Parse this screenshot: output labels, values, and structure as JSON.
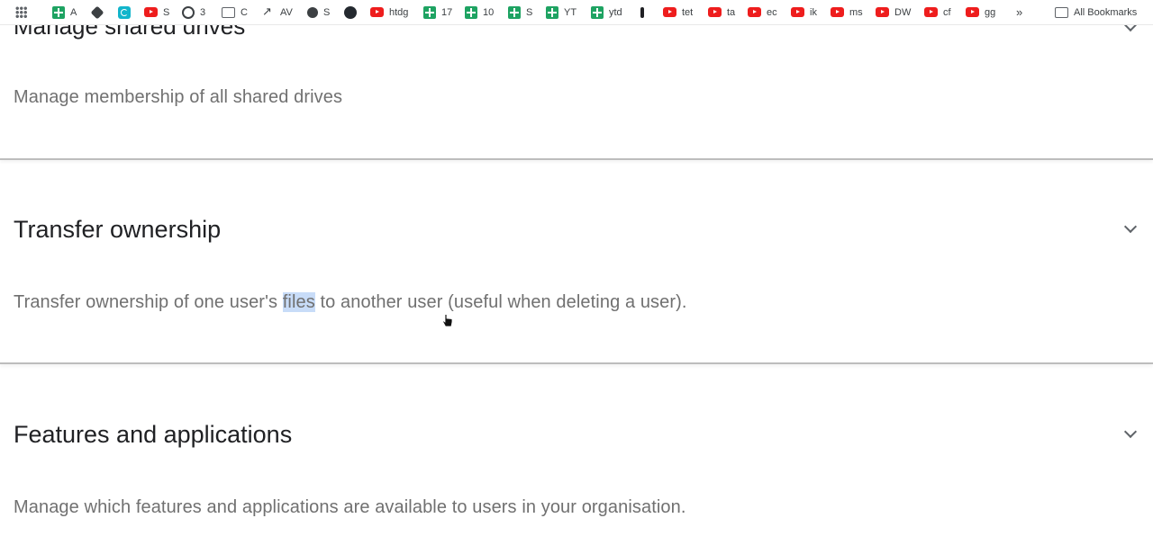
{
  "bookmarks_bar": {
    "items": [
      {
        "icon": "apps-grid-icon",
        "label": ""
      },
      {
        "icon": "sheets-icon",
        "label": "A"
      },
      {
        "icon": "puzzle-icon",
        "label": ""
      },
      {
        "icon": "cyan-app-icon",
        "label": ""
      },
      {
        "icon": "youtube-icon",
        "label": "S"
      },
      {
        "icon": "openai-icon",
        "label": "3"
      },
      {
        "icon": "folder-icon",
        "label": "C"
      },
      {
        "icon": "trend-icon",
        "label": "AV"
      },
      {
        "icon": "globe-icon",
        "label": "S"
      },
      {
        "icon": "github-icon",
        "label": ""
      },
      {
        "icon": "youtube-icon",
        "label": "htdg"
      },
      {
        "icon": "sheets-icon",
        "label": "17"
      },
      {
        "icon": "sheets-icon",
        "label": "10"
      },
      {
        "icon": "sheets-icon",
        "label": "S"
      },
      {
        "icon": "sheets-icon",
        "label": "YT"
      },
      {
        "icon": "sheets-icon",
        "label": "ytd"
      },
      {
        "icon": "pin-icon",
        "label": ""
      },
      {
        "icon": "youtube-icon",
        "label": "tet"
      },
      {
        "icon": "youtube-icon",
        "label": "ta"
      },
      {
        "icon": "youtube-icon",
        "label": "ec"
      },
      {
        "icon": "youtube-icon",
        "label": "ik"
      },
      {
        "icon": "youtube-icon",
        "label": "ms"
      },
      {
        "icon": "youtube-icon",
        "label": "DW"
      },
      {
        "icon": "youtube-icon",
        "label": "cf"
      },
      {
        "icon": "youtube-icon",
        "label": "gg"
      }
    ],
    "more_label": "»",
    "all_bookmarks_label": "All Bookmarks"
  },
  "sections": {
    "shared_drives": {
      "title": "Manage shared drives",
      "description": "Manage membership of all shared drives"
    },
    "transfer_ownership": {
      "title": "Transfer ownership",
      "description_before": "Transfer ownership of one user's ",
      "description_highlight": "files",
      "description_after": " to another user (useful when deleting a user)."
    },
    "features_apps": {
      "title": "Features and applications",
      "description": "Manage which features and applications are available to users in your organisation."
    }
  },
  "colors": {
    "title_text": "#202124",
    "description_text": "#707070",
    "selection_highlight": "#c8dcf8",
    "divider": "#bdbdbd"
  }
}
